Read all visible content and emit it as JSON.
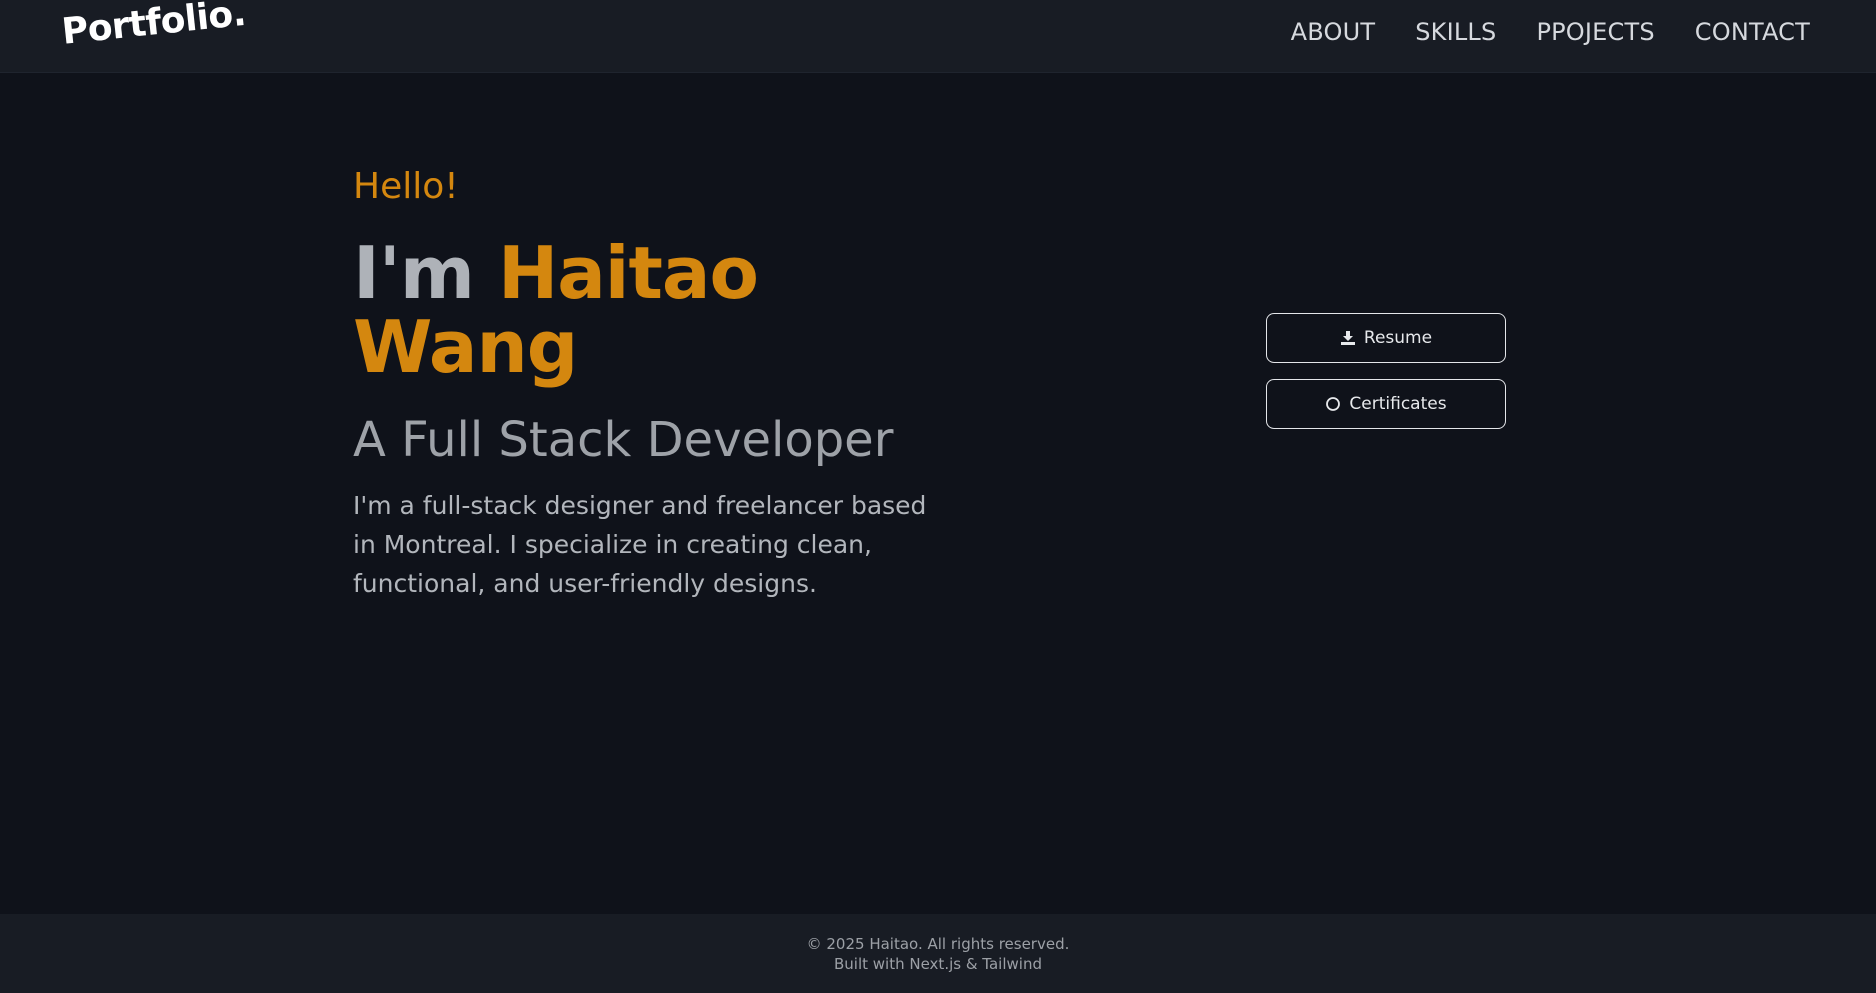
{
  "header": {
    "logo": "Portfolio.",
    "nav": [
      {
        "label": "ABOUT"
      },
      {
        "label": "SKILLS"
      },
      {
        "label": "PPOJECTS"
      },
      {
        "label": "CONTACT"
      }
    ]
  },
  "hero": {
    "greeting": "Hello!",
    "im": "I'm",
    "first_name": "Haitao",
    "last_name": "Wang",
    "role": "A Full Stack Developer",
    "bio": "I'm a full-stack designer and freelancer based in Montreal. I specialize in creating clean, functional, and user-friendly designs."
  },
  "actions": {
    "resume": {
      "label": "Resume",
      "icon": "download-icon"
    },
    "certificates": {
      "label": "Certificates",
      "icon": "circle-icon"
    }
  },
  "footer": {
    "copyright": "© 2025 Haitao. All rights reserved.",
    "built_with": "Built with Next.js & Tailwind"
  },
  "colors": {
    "accent": "#d4870f",
    "background": "#0f121a",
    "header_bg": "#181c24"
  }
}
